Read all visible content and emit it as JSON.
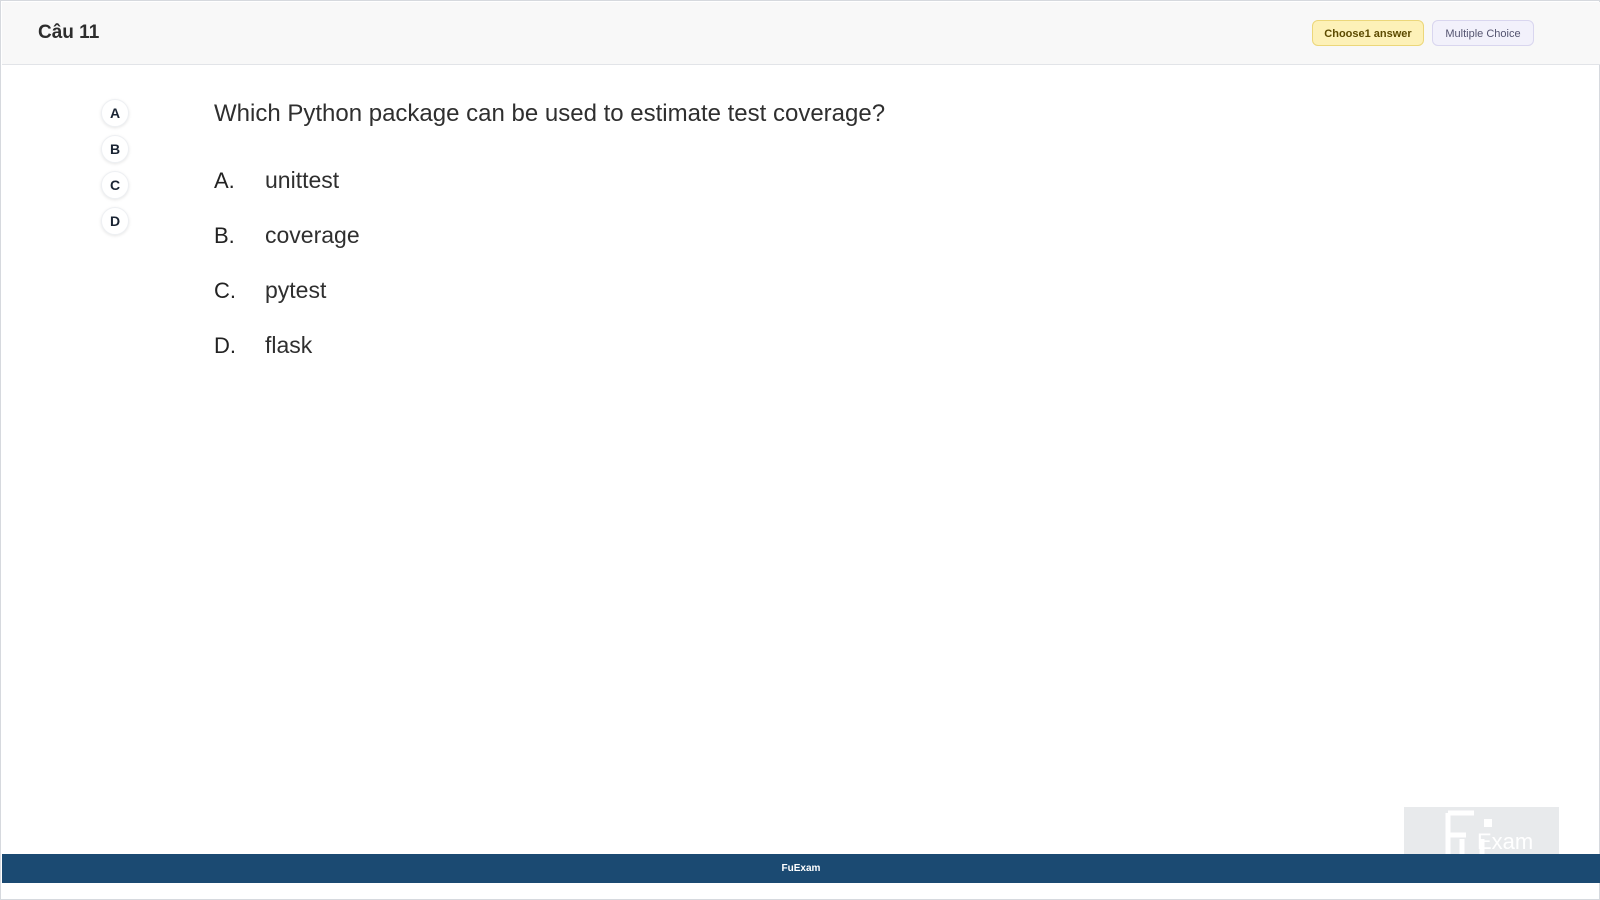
{
  "header": {
    "question_number": "Câu 11",
    "badge_choose": "Choose1 answer",
    "badge_type": "Multiple Choice"
  },
  "nav": {
    "items": [
      "A",
      "B",
      "C",
      "D"
    ]
  },
  "question": {
    "text": "Which Python package can be used to estimate test coverage?",
    "options": [
      {
        "letter": "A.",
        "text": "unittest"
      },
      {
        "letter": "B.",
        "text": "coverage"
      },
      {
        "letter": "C.",
        "text": "pytest"
      },
      {
        "letter": "D.",
        "text": "flask"
      }
    ]
  },
  "footer": {
    "brand": "FuExam"
  },
  "logo": {
    "text": "Exam"
  },
  "colors": {
    "footer_bg": "#1b4a72",
    "badge_choose_bg": "#fdf1b8",
    "badge_type_bg": "#f2f1fb"
  }
}
